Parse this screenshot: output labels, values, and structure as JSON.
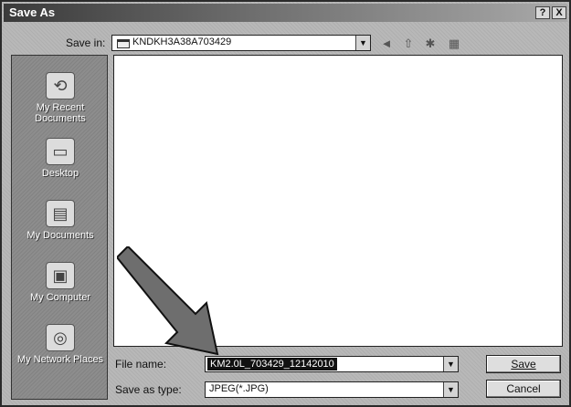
{
  "window": {
    "title": "Save As"
  },
  "titlebar": {
    "help": "?",
    "close": "X"
  },
  "save_in": {
    "label": "Save in:",
    "value": "KNDKH3A38A703429"
  },
  "places": [
    {
      "label": "My Recent Documents",
      "icon": "recent-documents-icon"
    },
    {
      "label": "Desktop",
      "icon": "desktop-icon"
    },
    {
      "label": "My Documents",
      "icon": "my-documents-icon"
    },
    {
      "label": "My Computer",
      "icon": "my-computer-icon"
    },
    {
      "label": "My Network Places",
      "icon": "network-places-icon"
    }
  ],
  "file_name": {
    "label": "File name:",
    "value": "KM2.0L_703429_12142010"
  },
  "save_as_type": {
    "label": "Save as type:",
    "value": "JPEG(*.JPG)"
  },
  "buttons": {
    "save": "Save",
    "cancel": "Cancel"
  }
}
